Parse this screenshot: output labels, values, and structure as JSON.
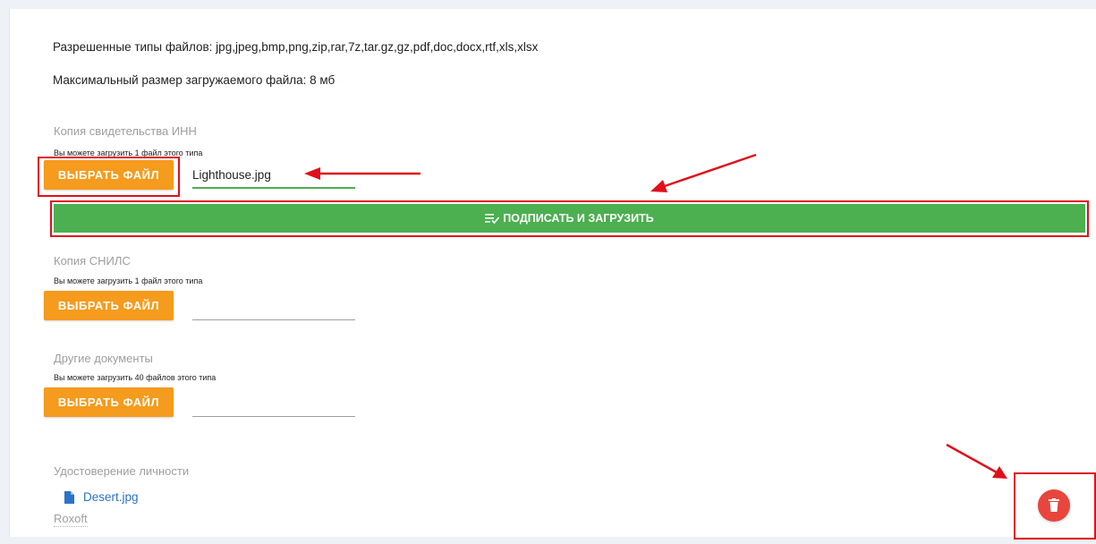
{
  "info": {
    "allowed_types": "Разрешенные типы файлов: jpg,jpeg,bmp,png,zip,rar,7z,tar.gz,gz,pdf,doc,docx,rtf,xls,xlsx",
    "max_size": "Максимальный размер загружаемого файла: 8 мб"
  },
  "sections": [
    {
      "label": "Копия свидетельства ИНН",
      "hint": "Вы можете загрузить 1 файл этого типа",
      "button": "ВЫБРАТЬ ФАЙЛ",
      "file_value": "Lighthouse.jpg"
    },
    {
      "label": "Копия СНИЛС",
      "hint": "Вы можете загрузить 1 файл этого типа",
      "button": "ВЫБРАТЬ ФАЙЛ",
      "file_value": ""
    },
    {
      "label": "Другие документы",
      "hint": "Вы можете загрузить 40 файлов этого типа",
      "button": "ВЫБРАТЬ ФАЙЛ",
      "file_value": ""
    }
  ],
  "sign_button": {
    "label": "ПОДПИСАТЬ И ЗАГРУЗИТЬ",
    "icon": "sign-list-icon"
  },
  "identity": {
    "label": "Удостоверение личности",
    "file_name": "Desert.jpg",
    "file_icon": "file-icon",
    "owner": "Roxoft"
  },
  "delete_button": {
    "icon": "trash-icon"
  },
  "colors": {
    "orange": "#f59b1d",
    "green": "#4caf50",
    "red_fab": "#e8453c",
    "highlight": "#e0101a",
    "link": "#2b73c7"
  }
}
